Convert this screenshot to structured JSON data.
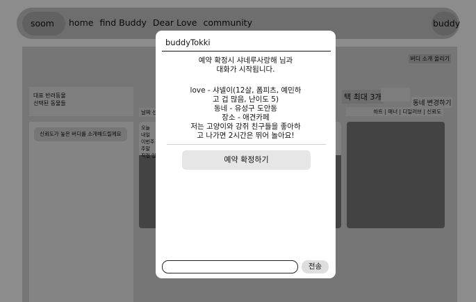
{
  "nav": {
    "logo": "soom",
    "links": [
      "home",
      "find Buddy",
      "Dear Love",
      "community"
    ],
    "profile": "buddy"
  },
  "page": {
    "upload_button": "버디 소개 올리기",
    "pet_box": {
      "line1": "대표 반려동물",
      "line2": "선택된 동물들"
    },
    "trust_button": "신뢰도가 높은 버디를 소개해드릴께요",
    "date_label": "날짜 선",
    "card1_info": {
      "line1": "오늘",
      "line2": "내일",
      "line3": "이번주",
      "line4": "주말",
      "line5": "직접 입"
    },
    "max_label": "택 최대 3개",
    "change_label": "동네 변경하기",
    "sort_options": "하트 | 매너 | 디일러브 | 신뢰도"
  },
  "modal": {
    "title": "buddyTokki",
    "message1": {
      "line1": "예약 확정시 샤네루사랑해 님과",
      "line2": "대화가 시작됩니다."
    },
    "message2": {
      "line1": "love - 샤넬이(12살, 폼피츠, 예민하",
      "line2": "고 겁 많음, 난이도 5)",
      "line3": "동네 - 유성구 도안동",
      "line4": "장소 - 애견카페",
      "line5": "저는 고양이와 강쥐 친구들을 좋아하",
      "line6": "고 나가면 2시간은 뛰어 놀아요!"
    },
    "confirm_button": "예약 확정하기",
    "input_value": "",
    "send_button": "전송"
  }
}
